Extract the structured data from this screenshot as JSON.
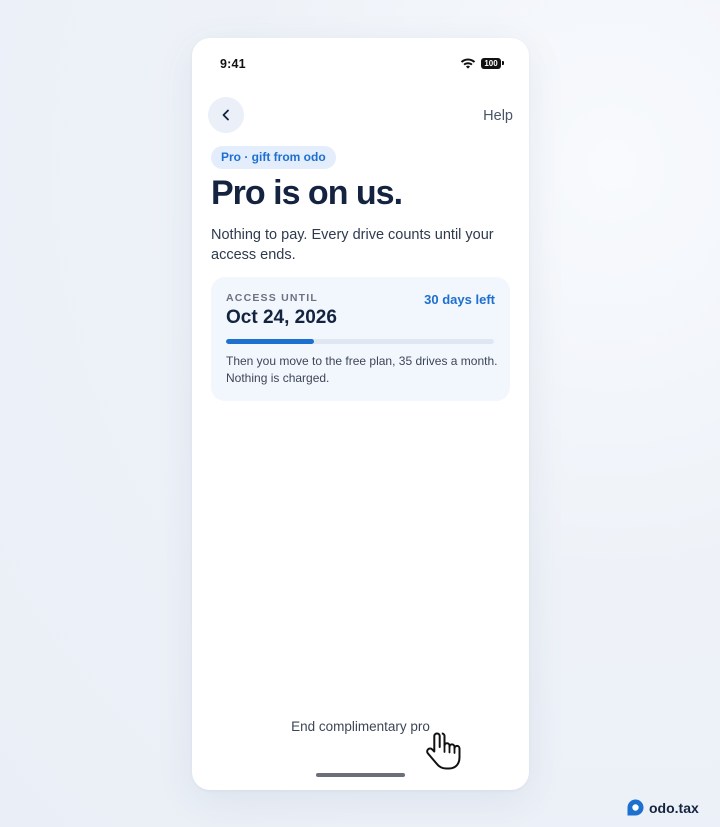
{
  "status_bar": {
    "time": "9:41",
    "battery": "100",
    "icons": [
      "wifi-icon",
      "battery-icon"
    ]
  },
  "header": {
    "back_icon": "chevron-left-icon",
    "help_label": "Help"
  },
  "badge": "Pro · gift from odo",
  "title": "Pro is on us.",
  "subtitle": "Nothing to pay. Every drive counts until your access ends.",
  "access_card": {
    "label": "ACCESS UNTIL",
    "date": "Oct 24, 2026",
    "days_left": "30 days left",
    "progress_fraction": 0.33,
    "note": "Then you move to the free plan, 35 drives a month. Nothing is charged."
  },
  "footer": {
    "end_label": "End complimentary pro"
  },
  "brand": {
    "name": "odo.tax",
    "logo_icon": "odo-logo-icon"
  },
  "colors": {
    "accent": "#1d6fd0",
    "badge_bg": "#e3edfb",
    "card_bg": "#f2f6fd",
    "title": "#14233f"
  }
}
